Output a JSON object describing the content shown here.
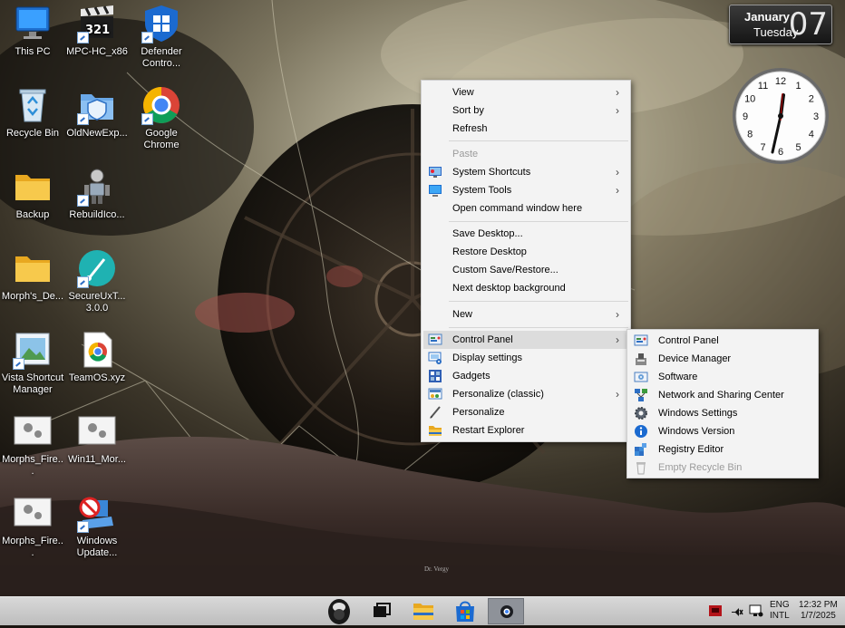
{
  "desktop": {
    "icons": [
      {
        "label": "This PC"
      },
      {
        "label": "MPC-HC_x86"
      },
      {
        "label": "Defender Contro..."
      },
      {
        "label": "Recycle Bin"
      },
      {
        "label": "OldNewExp..."
      },
      {
        "label": "Google Chrome"
      },
      {
        "label": "Backup"
      },
      {
        "label": "RebuildIco..."
      },
      {
        "label": "Morph's_De..."
      },
      {
        "label": "SecureUxT... 3.0.0"
      },
      {
        "label": "Vista Shortcut Manager"
      },
      {
        "label": "TeamOS.xyz"
      },
      {
        "label": "Morphs_Fire..."
      },
      {
        "label": "Win11_Mor..."
      },
      {
        "label": "Morphs_Fire..."
      },
      {
        "label": "Windows Update..."
      }
    ],
    "mpc_badge": "321",
    "wallpaper_signature": "Dr. Vergy"
  },
  "gadget": {
    "month": "January",
    "weekday": "Tuesday",
    "day": "07",
    "clock_numbers": [
      "12",
      "1",
      "2",
      "3",
      "4",
      "5",
      "6",
      "7",
      "8",
      "9",
      "10",
      "11"
    ]
  },
  "context_menu": {
    "items": [
      {
        "label": "View",
        "submenu": true
      },
      {
        "label": "Sort by",
        "submenu": true
      },
      {
        "label": "Refresh"
      },
      {
        "label": "Paste",
        "disabled": true
      },
      {
        "label": "System Shortcuts",
        "submenu": true
      },
      {
        "label": "System Tools",
        "submenu": true
      },
      {
        "label": "Open command window here"
      },
      {
        "label": "Save Desktop..."
      },
      {
        "label": "Restore Desktop"
      },
      {
        "label": "Custom Save/Restore..."
      },
      {
        "label": "Next desktop background"
      },
      {
        "label": "New",
        "submenu": true
      },
      {
        "label": "Control Panel",
        "submenu": true,
        "highlighted": true
      },
      {
        "label": "Display settings"
      },
      {
        "label": "Gadgets"
      },
      {
        "label": "Personalize (classic)",
        "submenu": true
      },
      {
        "label": "Personalize"
      },
      {
        "label": "Restart Explorer"
      }
    ],
    "arrow": "›"
  },
  "control_panel_submenu": {
    "items": [
      {
        "label": "Control Panel"
      },
      {
        "label": "Device Manager"
      },
      {
        "label": "Software"
      },
      {
        "label": "Network and Sharing Center"
      },
      {
        "label": "Windows Settings"
      },
      {
        "label": "Windows Version"
      },
      {
        "label": "Registry Editor"
      },
      {
        "label": "Empty Recycle Bin",
        "disabled": true
      }
    ]
  },
  "taskbar": {
    "lang_top": "ENG",
    "lang_bottom": "INTL",
    "time": "12:32 PM",
    "date": "1/7/2025"
  }
}
